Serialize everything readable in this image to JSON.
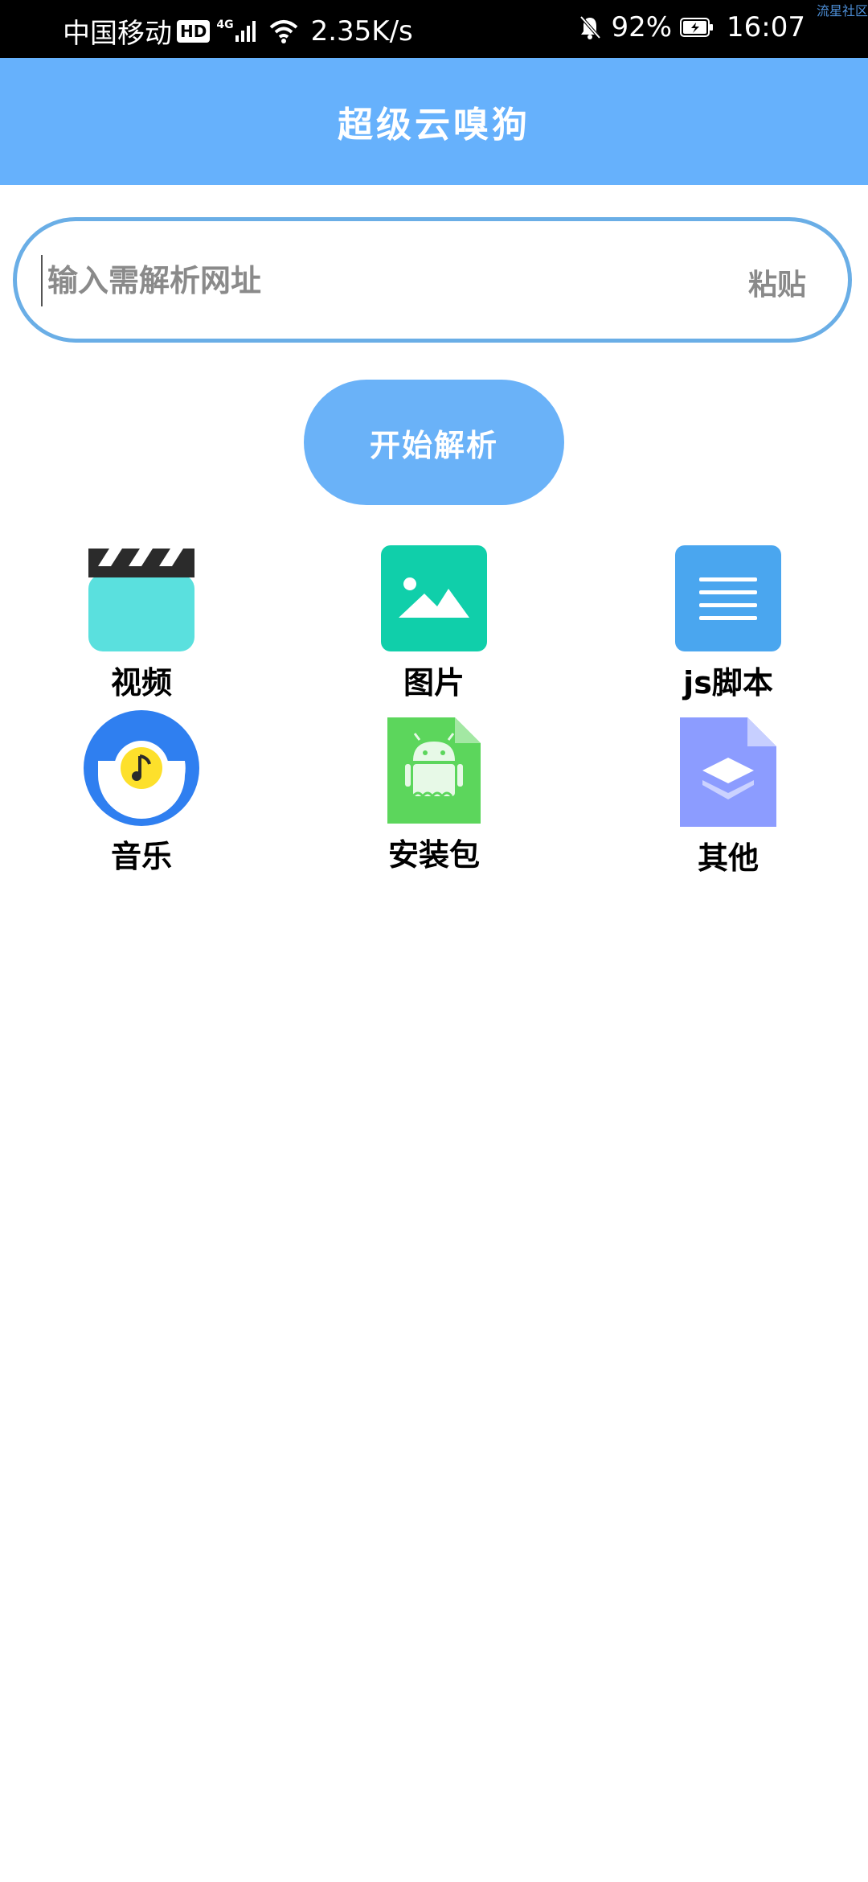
{
  "status_bar": {
    "carrier": "中国移动",
    "hd": "HD",
    "network": "4G",
    "speed": "2.35K/s",
    "battery": "92%",
    "time": "16:07"
  },
  "corner_text": "流星社区",
  "app": {
    "title": "超级云嗅狗"
  },
  "search": {
    "placeholder": "输入需解析网址",
    "paste_label": "粘贴"
  },
  "start_button": {
    "label": "开始解析"
  },
  "categories": [
    {
      "label": "视频",
      "icon": "video-icon",
      "color": "#5ae0de"
    },
    {
      "label": "图片",
      "icon": "image-icon",
      "color": "#10cfaa"
    },
    {
      "label": "js脚本",
      "icon": "document-icon",
      "color": "#4aa6ef"
    },
    {
      "label": "音乐",
      "icon": "music-icon",
      "color": "#2f7ff0"
    },
    {
      "label": "安装包",
      "icon": "android-icon",
      "color": "#5cd65c"
    },
    {
      "label": "其他",
      "icon": "layers-icon",
      "color": "#8c9cff"
    }
  ],
  "colors": {
    "app_bar": "#66b1fc",
    "search_border": "#6aaee6",
    "start_button": "#6ab2f8"
  }
}
